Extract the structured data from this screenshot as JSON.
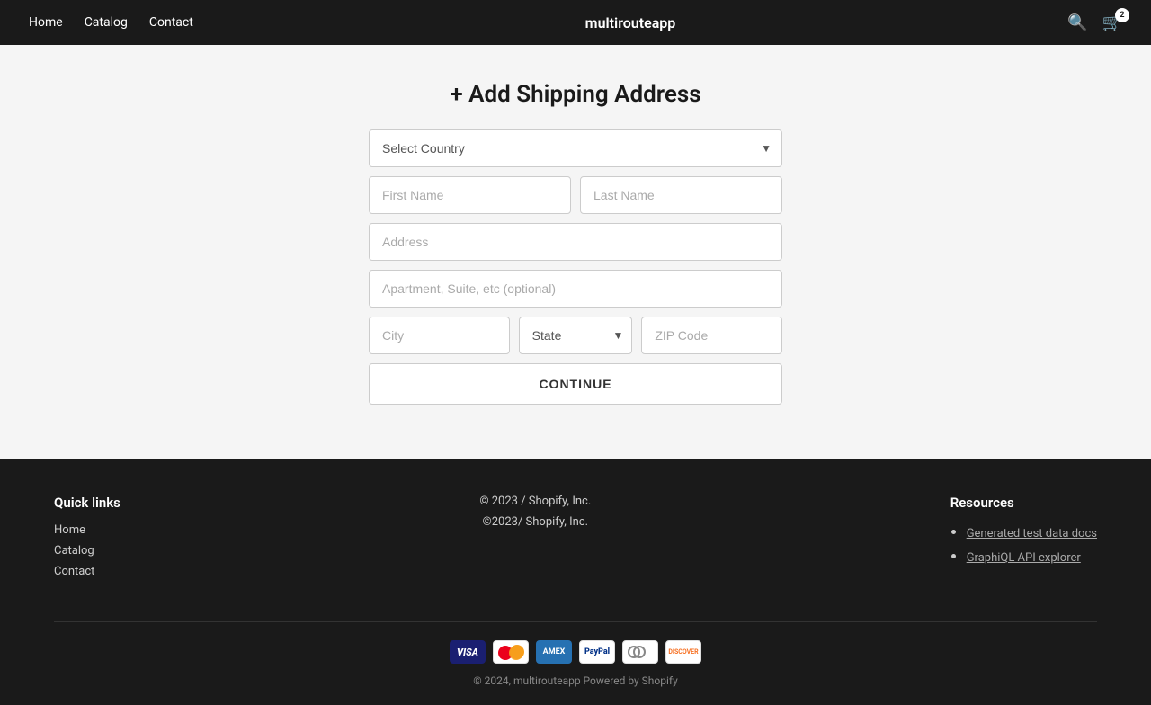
{
  "nav": {
    "brand": "multirouteapp",
    "links": [
      "Home",
      "Catalog",
      "Contact"
    ],
    "cart_count": "2"
  },
  "page": {
    "title": "+ Add Shipping Address"
  },
  "form": {
    "country_placeholder": "Select Country",
    "first_name_placeholder": "First Name",
    "last_name_placeholder": "Last Name",
    "address_placeholder": "Address",
    "apt_placeholder": "Apartment, Suite, etc (optional)",
    "city_placeholder": "City",
    "state_placeholder": "State",
    "zip_placeholder": "ZIP Code",
    "continue_label": "CONTINUE"
  },
  "footer": {
    "quick_links_heading": "Quick links",
    "quick_links": [
      "Home",
      "Catalog",
      "Contact"
    ],
    "copyright_center": "© 2023 / Shopify, Inc.",
    "copyright_center2": "©2023/ Shopify, Inc.",
    "resources_heading": "Resources",
    "resources": [
      {
        "label": "Generated test data docs",
        "url": "#"
      },
      {
        "label": "GraphiQL API explorer",
        "url": "#"
      }
    ],
    "bottom_copy": "© 2024, multirouteapp Powered by Shopify"
  },
  "payment_icons": [
    "Visa",
    "Mastercard",
    "Amex",
    "PayPal",
    "Diners",
    "Discover"
  ]
}
